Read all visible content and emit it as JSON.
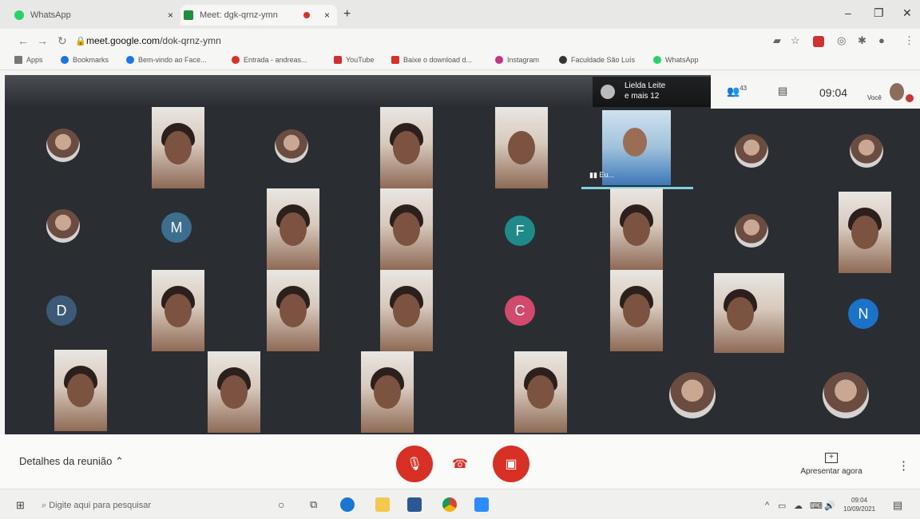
{
  "browser": {
    "tabs": [
      {
        "title": "WhatsApp",
        "favicon_color": "#25d366"
      },
      {
        "title": "Meet: dgk-qrnz-ymn",
        "favicon_color": "#1e8e3e",
        "active": true
      }
    ],
    "new_tab_symbol": "+",
    "url": "meet.google.com/dok-qrnz-ymn",
    "url_domain": "meet.google.com",
    "url_path": "/dok-qrnz-ymn",
    "bookmarks": [
      {
        "label": "Apps",
        "icon": "apps-grid-icon",
        "color": "#666"
      },
      {
        "label": "Bookmarks",
        "icon": "star-icon",
        "color": "#1a73e8"
      },
      {
        "label": "Bem-vindo ao Face...",
        "icon": "facebook-icon",
        "color": "#1877f2"
      },
      {
        "label": "Entrada - andreas...",
        "icon": "gmail-icon",
        "color": "#d93025"
      },
      {
        "label": "YouTube",
        "icon": "youtube-icon",
        "color": "#d32f2f"
      },
      {
        "label": "Baixe o download d...",
        "icon": "download-icon",
        "color": "#d93025"
      },
      {
        "label": "Instagram",
        "icon": "instagram-icon",
        "color": "#c13584"
      },
      {
        "label": "Faculdade São Luís",
        "icon": "bookmark-icon",
        "color": "#333"
      },
      {
        "label": "WhatsApp",
        "icon": "whatsapp-icon",
        "color": "#25d366"
      }
    ]
  },
  "meet": {
    "presenter_name": "Lielda Leite",
    "presenter_more": "e mais 12",
    "speaker_label": "Eu...",
    "participant_count": "43",
    "time": "09:04",
    "self_label": "Você",
    "initials": [
      "M",
      "F",
      "D",
      "C",
      "N"
    ],
    "initial_colors": {
      "M": "#3c6e8f",
      "F": "#1f8a8a",
      "D": "#3c5a78",
      "C": "#d24a6b",
      "N": "#1a73c9"
    },
    "meeting_details": "Detalhes da reunião",
    "present_now": "Apresentar agora"
  },
  "taskbar": {
    "search_placeholder": "Digite aqui para pesquisar",
    "clock_time": "09:04",
    "clock_date": "10/09/2021"
  }
}
